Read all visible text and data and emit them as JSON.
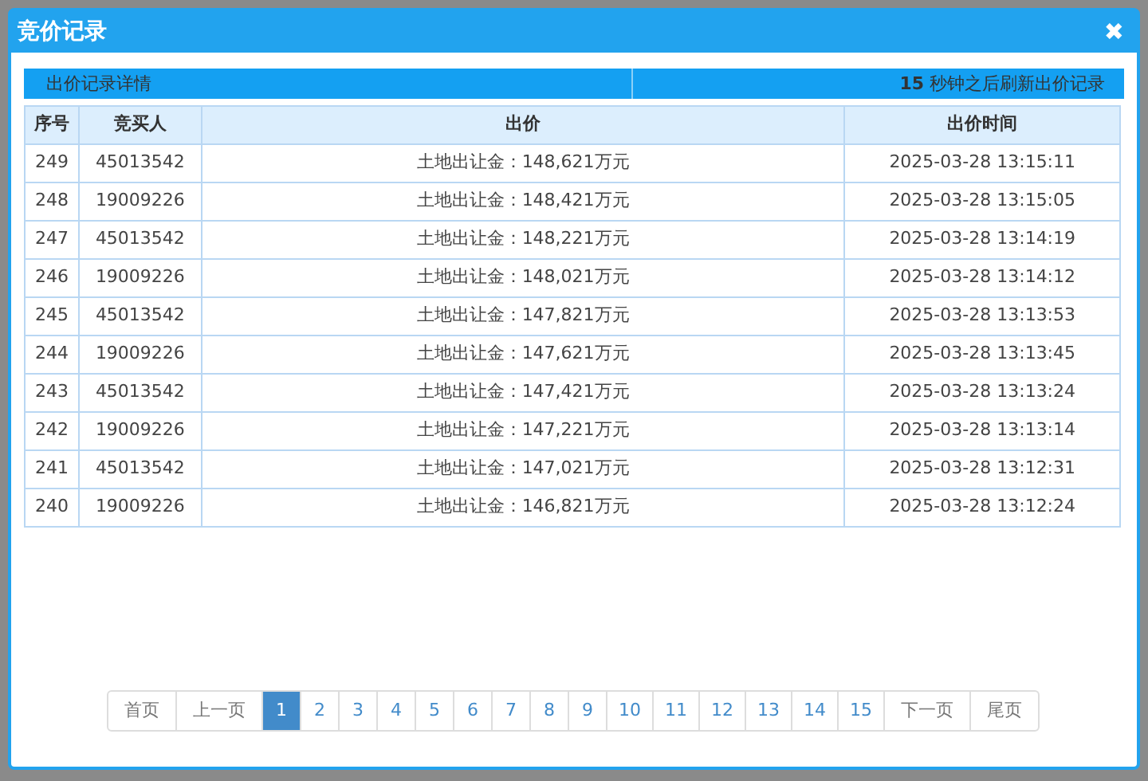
{
  "dialog": {
    "title": "竞价记录",
    "close": "✖"
  },
  "info_bar": {
    "label": "出价记录详情",
    "countdown": "**15** 秒钟之后刷新出价记录"
  },
  "table": {
    "columns": [
      "序号",
      "竞买人",
      "出价",
      "出价时间"
    ],
    "rows": [
      [
        "249",
        "45013542",
        "土地出让金：148,621万元",
        "2025-03-28 13:15:11"
      ],
      [
        "248",
        "19009226",
        "土地出让金：148,421万元",
        "2025-03-28 13:15:05"
      ],
      [
        "247",
        "45013542",
        "土地出让金：148,221万元",
        "2025-03-28 13:14:19"
      ],
      [
        "246",
        "19009226",
        "土地出让金：148,021万元",
        "2025-03-28 13:14:12"
      ],
      [
        "245",
        "45013542",
        "土地出让金：147,821万元",
        "2025-03-28 13:13:53"
      ],
      [
        "244",
        "19009226",
        "土地出让金：147,621万元",
        "2025-03-28 13:13:45"
      ],
      [
        "243",
        "45013542",
        "土地出让金：147,421万元",
        "2025-03-28 13:13:24"
      ],
      [
        "242",
        "19009226",
        "土地出让金：147,221万元",
        "2025-03-28 13:13:14"
      ],
      [
        "241",
        "45013542",
        "土地出让金：147,021万元",
        "2025-03-28 13:12:31"
      ],
      [
        "240",
        "19009226",
        "土地出让金：146,821万元",
        "2025-03-28 13:12:24"
      ]
    ]
  },
  "pagination": [
    {
      "label": "首页",
      "kind": "nav",
      "selected": false
    },
    {
      "label": "上一页",
      "kind": "nav",
      "selected": false
    },
    {
      "label": "1",
      "kind": "page",
      "selected": true
    },
    {
      "label": "2",
      "kind": "page",
      "selected": false
    },
    {
      "label": "3",
      "kind": "page",
      "selected": false
    },
    {
      "label": "4",
      "kind": "page",
      "selected": false
    },
    {
      "label": "5",
      "kind": "page",
      "selected": false
    },
    {
      "label": "6",
      "kind": "page",
      "selected": false
    },
    {
      "label": "7",
      "kind": "page",
      "selected": false
    },
    {
      "label": "8",
      "kind": "page",
      "selected": false
    },
    {
      "label": "9",
      "kind": "page",
      "selected": false
    },
    {
      "label": "10",
      "kind": "page",
      "selected": false
    },
    {
      "label": "11",
      "kind": "page",
      "selected": false
    },
    {
      "label": "12",
      "kind": "page",
      "selected": false
    },
    {
      "label": "13",
      "kind": "page",
      "selected": false
    },
    {
      "label": "14",
      "kind": "page",
      "selected": false
    },
    {
      "label": "15",
      "kind": "page",
      "selected": false
    },
    {
      "label": "下一页",
      "kind": "nav",
      "selected": false
    },
    {
      "label": "尾页",
      "kind": "nav",
      "selected": false
    }
  ]
}
